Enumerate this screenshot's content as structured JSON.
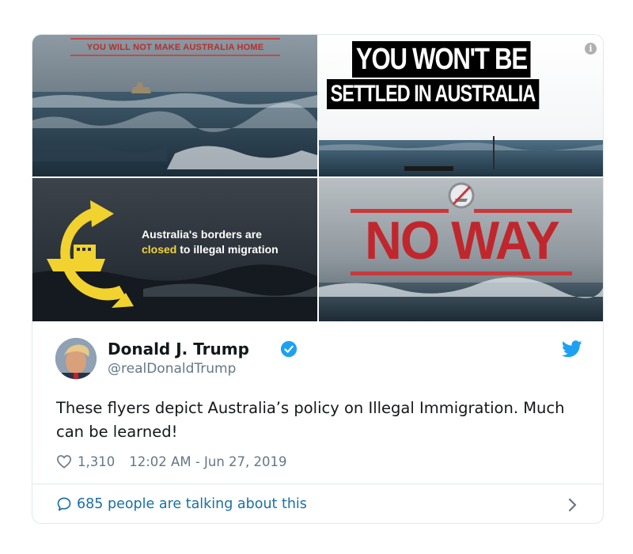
{
  "flyers": {
    "tile1_banner": "YOU WILL NOT MAKE AUSTRALIA HOME",
    "tile2_line1": "YOU WON'T BE",
    "tile2_line2": "SETTLED IN AUSTRALIA",
    "tile3_line1": "Australia's borders are",
    "tile3_highlight": "closed",
    "tile3_line2_rest": " to illegal migration",
    "tile4_text": "NO WAY"
  },
  "tweet": {
    "author_name": "Donald J. Trump",
    "author_handle": "@realDonaldTrump",
    "text": "These flyers depict Australia’s policy on Illegal Immigration. Much can be learned!",
    "likes": "1,310",
    "timestamp": "12:02 AM - Jun 27, 2019",
    "conversation": "685 people are talking about this"
  },
  "icons": {
    "info": "info-icon",
    "verified": "verified-badge-icon",
    "brand": "twitter-bird-icon",
    "like": "heart-icon",
    "reply": "speech-bubble-icon",
    "more": "chevron-right-icon"
  },
  "colors": {
    "twitter_blue": "#1da1f2",
    "link_blue": "#1b6fa5",
    "muted_gray": "#657786",
    "border": "#e1e8ed",
    "no_way_red": "#c0272d",
    "highlight_yellow": "#f4d33a"
  }
}
